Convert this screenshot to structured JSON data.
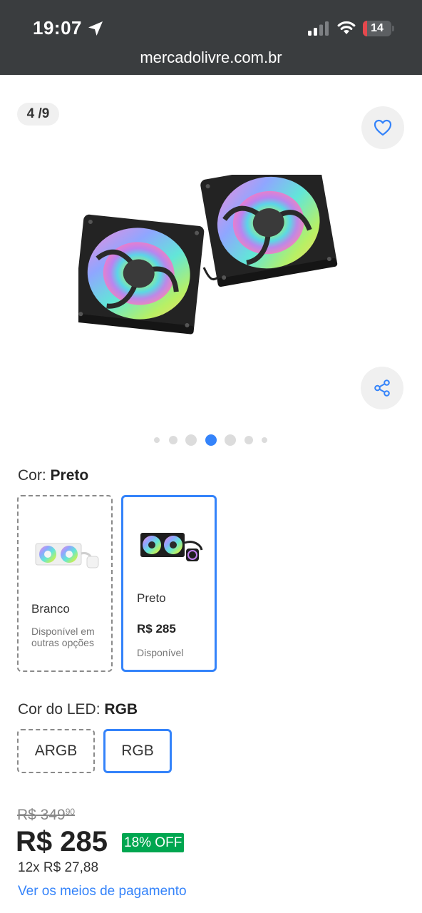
{
  "status_bar": {
    "time": "19:07",
    "battery": "14",
    "battery_level_percent": 14,
    "icons": [
      "location-arrow-icon",
      "signal-icon",
      "wifi-icon",
      "battery-icon"
    ]
  },
  "browser": {
    "url": "mercadolivre.com.br"
  },
  "gallery": {
    "counter": "4 /9",
    "current_index": 4,
    "total_images": 9,
    "icons": [
      "heart-icon",
      "share-icon"
    ]
  },
  "color_option": {
    "label": "Cor:",
    "selected": "Preto",
    "variants": [
      {
        "name": "Branco",
        "availability": "Disponível em outras opções",
        "selected": false
      },
      {
        "name": "Preto",
        "price": "R$ 285",
        "availability": "Disponível",
        "selected": true
      }
    ]
  },
  "led_option": {
    "label": "Cor do LED:",
    "selected": "RGB",
    "options": [
      {
        "label": "ARGB",
        "selected": false
      },
      {
        "label": "RGB",
        "selected": true
      }
    ]
  },
  "pricing": {
    "old_price": "R$ 349",
    "old_price_cents": "90",
    "price": "R$ 285",
    "discount": "18% OFF",
    "installments": "12x R$ 27,88",
    "payment_link": "Ver os meios de pagamento"
  },
  "colors": {
    "accent": "#3483fa",
    "discount_green": "#00a650",
    "status_bar_bg": "#3a3d3f",
    "battery_low": "#e5484d"
  }
}
